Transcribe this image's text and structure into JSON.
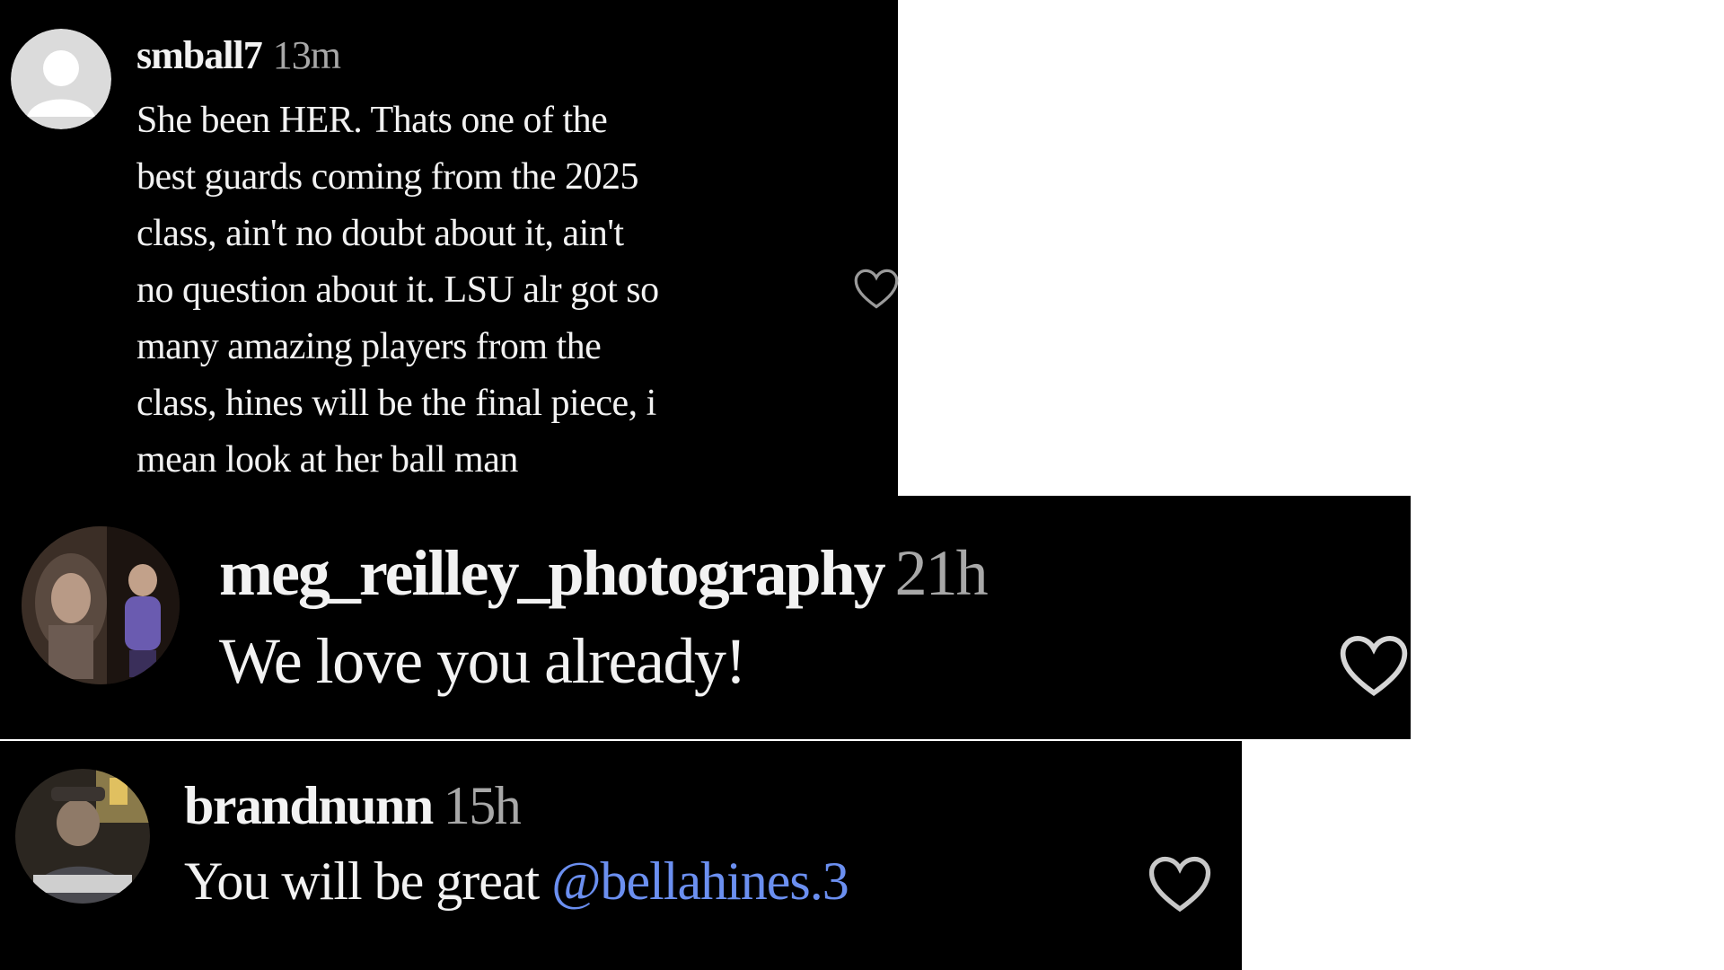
{
  "comments": [
    {
      "username": "smball7",
      "time": "13m",
      "text_lines": [
        "She been HER. Thats one of the",
        "best guards coming from the 2025",
        "class, ain't no doubt about it, ain't",
        "no question about it. LSU alr got so",
        "many amazing players from the",
        "class, hines will be the final piece, i",
        "mean look at her ball man"
      ],
      "avatar": "default-avatar-icon",
      "like_icon": "heart-outline-icon"
    },
    {
      "username": "meg_reilley_photography",
      "time": "21h",
      "text": "We love you already!",
      "avatar": "user-avatar-photo",
      "like_icon": "heart-outline-icon"
    },
    {
      "username": "brandnunn",
      "time": "15h",
      "text": "You will be great",
      "mention": "@bellahines.3",
      "avatar": "user-avatar-photo",
      "like_icon": "heart-outline-icon"
    }
  ],
  "colors": {
    "panel_background": "#000000",
    "page_background": "#ffffff",
    "text": "#f2f2f2",
    "timestamp": "#a8a8a8",
    "mention": "#6b8ff0"
  }
}
